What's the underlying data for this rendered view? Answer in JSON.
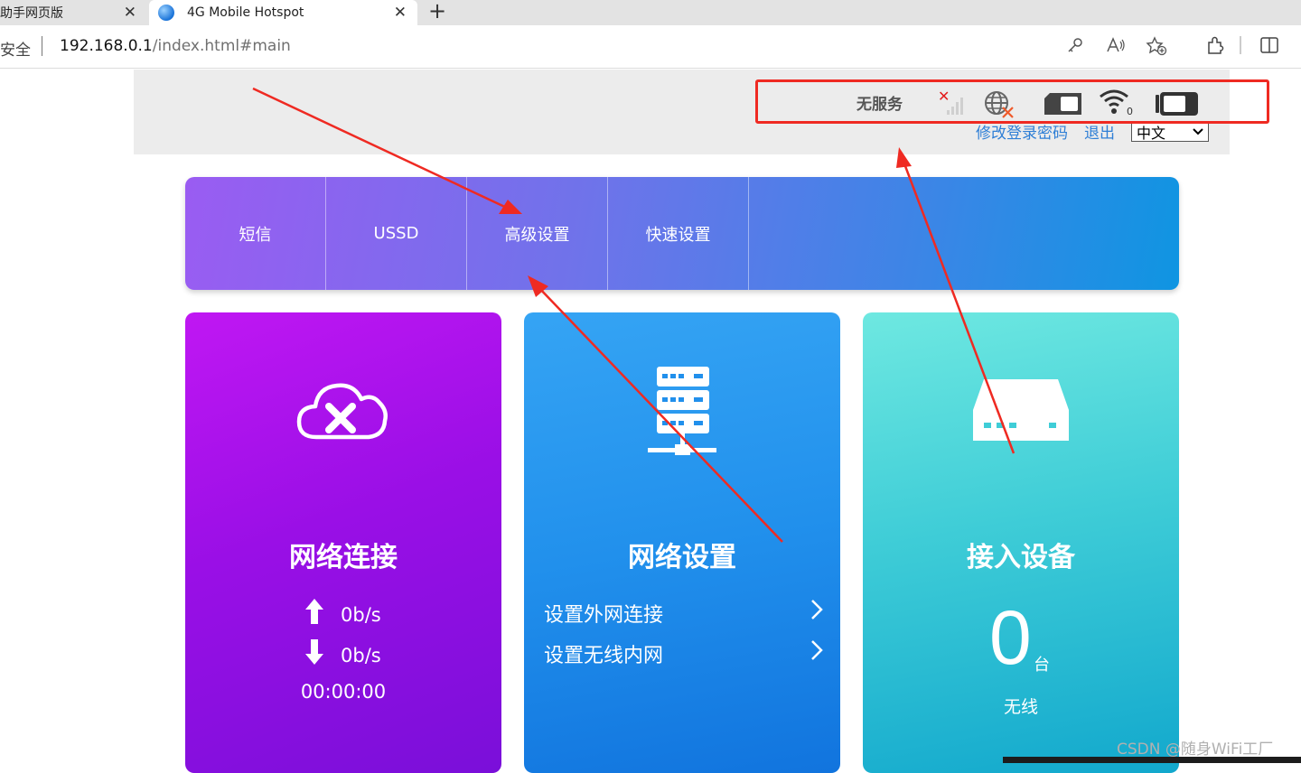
{
  "browser": {
    "tabs": [
      {
        "title": "助手网页版"
      },
      {
        "title": "4G Mobile Hotspot"
      }
    ],
    "security_label": "安全",
    "url_host": "192.168.0.1",
    "url_path": "/index.html#main"
  },
  "header": {
    "status_text": "无服务",
    "change_password": "修改登录密码",
    "logout": "退出",
    "language": "中文"
  },
  "nav": {
    "items": [
      {
        "label": "短信"
      },
      {
        "label": "USSD"
      },
      {
        "label": "高级设置"
      },
      {
        "label": "快速设置"
      }
    ]
  },
  "cards": {
    "connection": {
      "title": "网络连接",
      "upload": "0b/s",
      "download": "0b/s",
      "uptime": "00:00:00"
    },
    "network": {
      "title": "网络设置",
      "links": [
        {
          "label": "设置外网连接"
        },
        {
          "label": "设置无线内网"
        }
      ]
    },
    "devices": {
      "title": "接入设备",
      "count": "0",
      "unit": "台",
      "type": "无线"
    }
  },
  "watermark": "CSDN @随身WiFi工厂",
  "colors": {
    "annotation_red": "#ef2a22",
    "link_blue": "#2f7fd6",
    "card_purple": "#9a0fe6",
    "card_blue": "#2190ec",
    "card_teal": "#3fcdd7"
  },
  "icons": {
    "connection": "cloud-x-icon",
    "network": "server-rack-icon",
    "devices": "router-box-icon"
  }
}
